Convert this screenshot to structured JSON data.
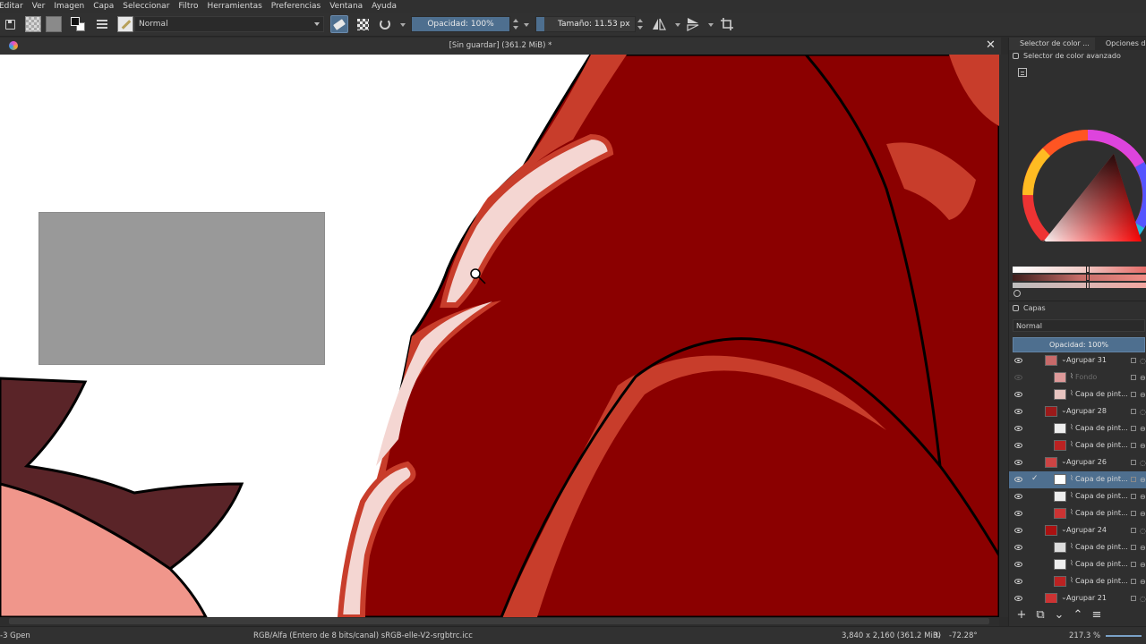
{
  "menu": [
    "Editar",
    "Ver",
    "Imagen",
    "Capa",
    "Seleccionar",
    "Filtro",
    "Herramientas",
    "Preferencias",
    "Ventana",
    "Ayuda"
  ],
  "toolbar": {
    "blend_mode": "Normal",
    "opacity_label": "Opacidad: 100%",
    "opacity_value": 1.0,
    "size_label": "Tamaño: 11.53 px",
    "size_value_fraction": 0.08,
    "accent": "#4e6f8f"
  },
  "document": {
    "title": "[Sin guardar]  (361.2 MiB) *",
    "close_glyph": "✕"
  },
  "canvas_colors": {
    "background": "#ffffff",
    "dark_red": "#8b0000",
    "mid_red": "#c83d2b",
    "highlight": "#f4d6d2",
    "outline": "#000000",
    "skin": "#f0968b",
    "hair_dark": "#5a2428",
    "grey_box": "#999999"
  },
  "dock": {
    "tabs": [
      "Selector de color ...",
      "Opciones de la"
    ],
    "color_docker_title": "Selector de color avanzado",
    "layers_title": "Capas",
    "layer_blend": "Normal",
    "layer_opacity": "Opacidad:  100%",
    "layers": [
      {
        "name": "Agrupar 31",
        "type": "group",
        "visible": true,
        "active": false,
        "thumb": "#c86a6a"
      },
      {
        "name": "Fondo",
        "type": "paint",
        "visible": false,
        "active": false,
        "thumb": "#d99"
      },
      {
        "name": "Capa de pint...",
        "type": "paint",
        "visible": true,
        "active": false,
        "thumb": "#e7c4c0"
      },
      {
        "name": "Agrupar 28",
        "type": "group",
        "visible": true,
        "active": false,
        "thumb": "#9b1a1a"
      },
      {
        "name": "Capa de pint...",
        "type": "paint",
        "visible": true,
        "active": false,
        "thumb": "#eeeeee"
      },
      {
        "name": "Capa de pint...",
        "type": "paint",
        "visible": true,
        "active": false,
        "thumb": "#b22"
      },
      {
        "name": "Agrupar 26",
        "type": "group",
        "visible": true,
        "active": false,
        "thumb": "#c44"
      },
      {
        "name": "Capa de pint...",
        "type": "paint",
        "visible": true,
        "active": true,
        "thumb": "#ffffff"
      },
      {
        "name": "Capa de pint...",
        "type": "paint",
        "visible": true,
        "active": false,
        "thumb": "#eeeeee"
      },
      {
        "name": "Capa de pint...",
        "type": "paint",
        "visible": true,
        "active": false,
        "thumb": "#c33"
      },
      {
        "name": "Agrupar 24",
        "type": "group",
        "visible": true,
        "active": false,
        "thumb": "#a11"
      },
      {
        "name": "Capa de pint...",
        "type": "paint",
        "visible": true,
        "active": false,
        "thumb": "#dddddd"
      },
      {
        "name": "Capa de pint...",
        "type": "paint",
        "visible": true,
        "active": false,
        "thumb": "#eeeeee"
      },
      {
        "name": "Capa de pint...",
        "type": "paint",
        "visible": true,
        "active": false,
        "thumb": "#b22"
      },
      {
        "name": "Agrupar 21",
        "type": "group",
        "visible": true,
        "active": false,
        "thumb": "#c33"
      }
    ],
    "footer_buttons": [
      "+",
      "⧉",
      "⌄",
      "⌃",
      "≡"
    ]
  },
  "status": {
    "brush": "-3 Gpen",
    "color_model": "RGB/Alfa (Entero de 8 bits/canal)  sRGB-elle-V2-srgbtrc.icc",
    "dimensions": "3,840 x 2,160 (361.2 MiB)",
    "rotation": "-72.28°",
    "zoom": "217.3 %"
  }
}
